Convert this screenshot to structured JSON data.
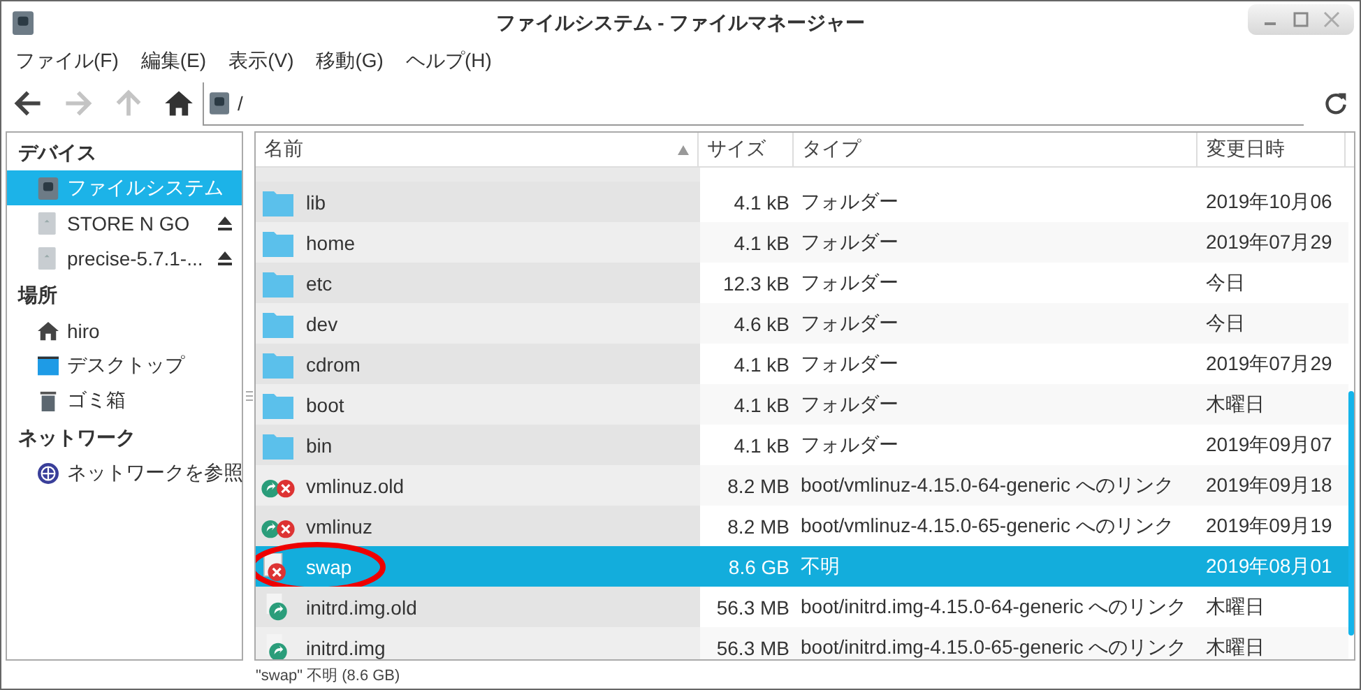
{
  "window": {
    "title": "ファイルシステム - ファイルマネージャー"
  },
  "menu": [
    "ファイル(F)",
    "編集(E)",
    "表示(V)",
    "移動(G)",
    "ヘルプ(H)"
  ],
  "toolbar": {
    "back_disabled": false,
    "forward_disabled": true,
    "up_disabled": true,
    "path": "/"
  },
  "sidebar": {
    "sections": [
      {
        "title": "デバイス",
        "items": [
          {
            "label": "ファイルシステム",
            "kind": "disk",
            "selected": true,
            "eject": false
          },
          {
            "label": "STORE N GO",
            "kind": "drive",
            "selected": false,
            "eject": true
          },
          {
            "label": "precise-5.7.1-...",
            "kind": "drive",
            "selected": false,
            "eject": true
          }
        ]
      },
      {
        "title": "場所",
        "items": [
          {
            "label": "hiro",
            "kind": "home",
            "selected": false,
            "eject": false
          },
          {
            "label": "デスクトップ",
            "kind": "desktop",
            "selected": false,
            "eject": false
          },
          {
            "label": "ゴミ箱",
            "kind": "trash",
            "selected": false,
            "eject": false
          }
        ]
      },
      {
        "title": "ネットワーク",
        "items": [
          {
            "label": "ネットワークを参照",
            "kind": "network",
            "selected": false,
            "eject": false
          }
        ]
      }
    ]
  },
  "table": {
    "columns": [
      "名前",
      "サイズ",
      "タイプ",
      "変更日時"
    ],
    "rows": [
      {
        "name": "lib",
        "size": "4.1 kB",
        "type": "フォルダー",
        "date": "2019年10月06",
        "kind": "folder",
        "selected": false,
        "circled": false
      },
      {
        "name": "home",
        "size": "4.1 kB",
        "type": "フォルダー",
        "date": "2019年07月29",
        "kind": "folder",
        "selected": false,
        "circled": false
      },
      {
        "name": "etc",
        "size": "12.3 kB",
        "type": "フォルダー",
        "date": "今日",
        "kind": "folder",
        "selected": false,
        "circled": false
      },
      {
        "name": "dev",
        "size": "4.6 kB",
        "type": "フォルダー",
        "date": "今日",
        "kind": "folder",
        "selected": false,
        "circled": false
      },
      {
        "name": "cdrom",
        "size": "4.1 kB",
        "type": "フォルダー",
        "date": "2019年07月29",
        "kind": "folder",
        "selected": false,
        "circled": false
      },
      {
        "name": "boot",
        "size": "4.1 kB",
        "type": "フォルダー",
        "date": "木曜日",
        "kind": "folder",
        "selected": false,
        "circled": false
      },
      {
        "name": "bin",
        "size": "4.1 kB",
        "type": "フォルダー",
        "date": "2019年09月07",
        "kind": "folder",
        "selected": false,
        "circled": false
      },
      {
        "name": "vmlinuz.old",
        "size": "8.2 MB",
        "type": "boot/vmlinuz-4.15.0-64-generic へのリンク",
        "date": "2019年09月18",
        "kind": "broken-link",
        "selected": false,
        "circled": false
      },
      {
        "name": "vmlinuz",
        "size": "8.2 MB",
        "type": "boot/vmlinuz-4.15.0-65-generic へのリンク",
        "date": "2019年09月19",
        "kind": "broken-link",
        "selected": false,
        "circled": false
      },
      {
        "name": "swap",
        "size": "8.6 GB",
        "type": "不明",
        "date": "2019年08月01",
        "kind": "broken-file",
        "selected": true,
        "circled": true
      },
      {
        "name": "initrd.img.old",
        "size": "56.3 MB",
        "type": "boot/initrd.img-4.15.0-64-generic へのリンク",
        "date": "木曜日",
        "kind": "link",
        "selected": false,
        "circled": false
      },
      {
        "name": "initrd.img",
        "size": "56.3 MB",
        "type": "boot/initrd.img-4.15.0-65-generic へのリンク",
        "date": "木曜日",
        "kind": "link",
        "selected": false,
        "circled": false
      }
    ]
  },
  "status_bar": "\"swap\" 不明 (8.6 GB)"
}
